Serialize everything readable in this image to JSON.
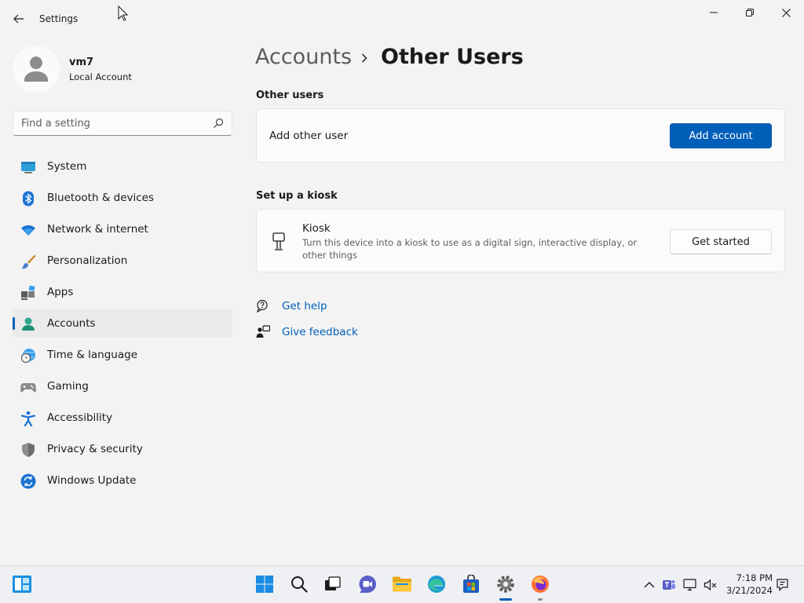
{
  "app": {
    "title": "Settings"
  },
  "profile": {
    "name": "vm7",
    "account_type": "Local Account"
  },
  "search": {
    "placeholder": "Find a setting"
  },
  "nav": {
    "items": [
      {
        "label": "System",
        "icon": "monitor-icon"
      },
      {
        "label": "Bluetooth & devices",
        "icon": "bluetooth-icon"
      },
      {
        "label": "Network & internet",
        "icon": "wifi-icon"
      },
      {
        "label": "Personalization",
        "icon": "paintbrush-icon"
      },
      {
        "label": "Apps",
        "icon": "apps-icon"
      },
      {
        "label": "Accounts",
        "icon": "accounts-icon",
        "active": true
      },
      {
        "label": "Time & language",
        "icon": "globe-clock-icon"
      },
      {
        "label": "Gaming",
        "icon": "gamepad-icon"
      },
      {
        "label": "Accessibility",
        "icon": "accessibility-icon"
      },
      {
        "label": "Privacy & security",
        "icon": "shield-icon"
      },
      {
        "label": "Windows Update",
        "icon": "update-icon"
      }
    ]
  },
  "breadcrumb": {
    "parent": "Accounts",
    "current": "Other Users"
  },
  "other_users": {
    "section_title": "Other users",
    "add_label": "Add other user",
    "add_button": "Add account"
  },
  "kiosk": {
    "section_title": "Set up a kiosk",
    "title": "Kiosk",
    "description": "Turn this device into a kiosk to use as a digital sign, interactive display, or other things",
    "button": "Get started"
  },
  "help": {
    "get_help": "Get help",
    "give_feedback": "Give feedback"
  },
  "taskbar": {
    "time": "7:18 PM",
    "date": "3/21/2024"
  },
  "colors": {
    "accent": "#005fb8",
    "background": "#f3f3f3",
    "card": "#fbfbfb"
  }
}
